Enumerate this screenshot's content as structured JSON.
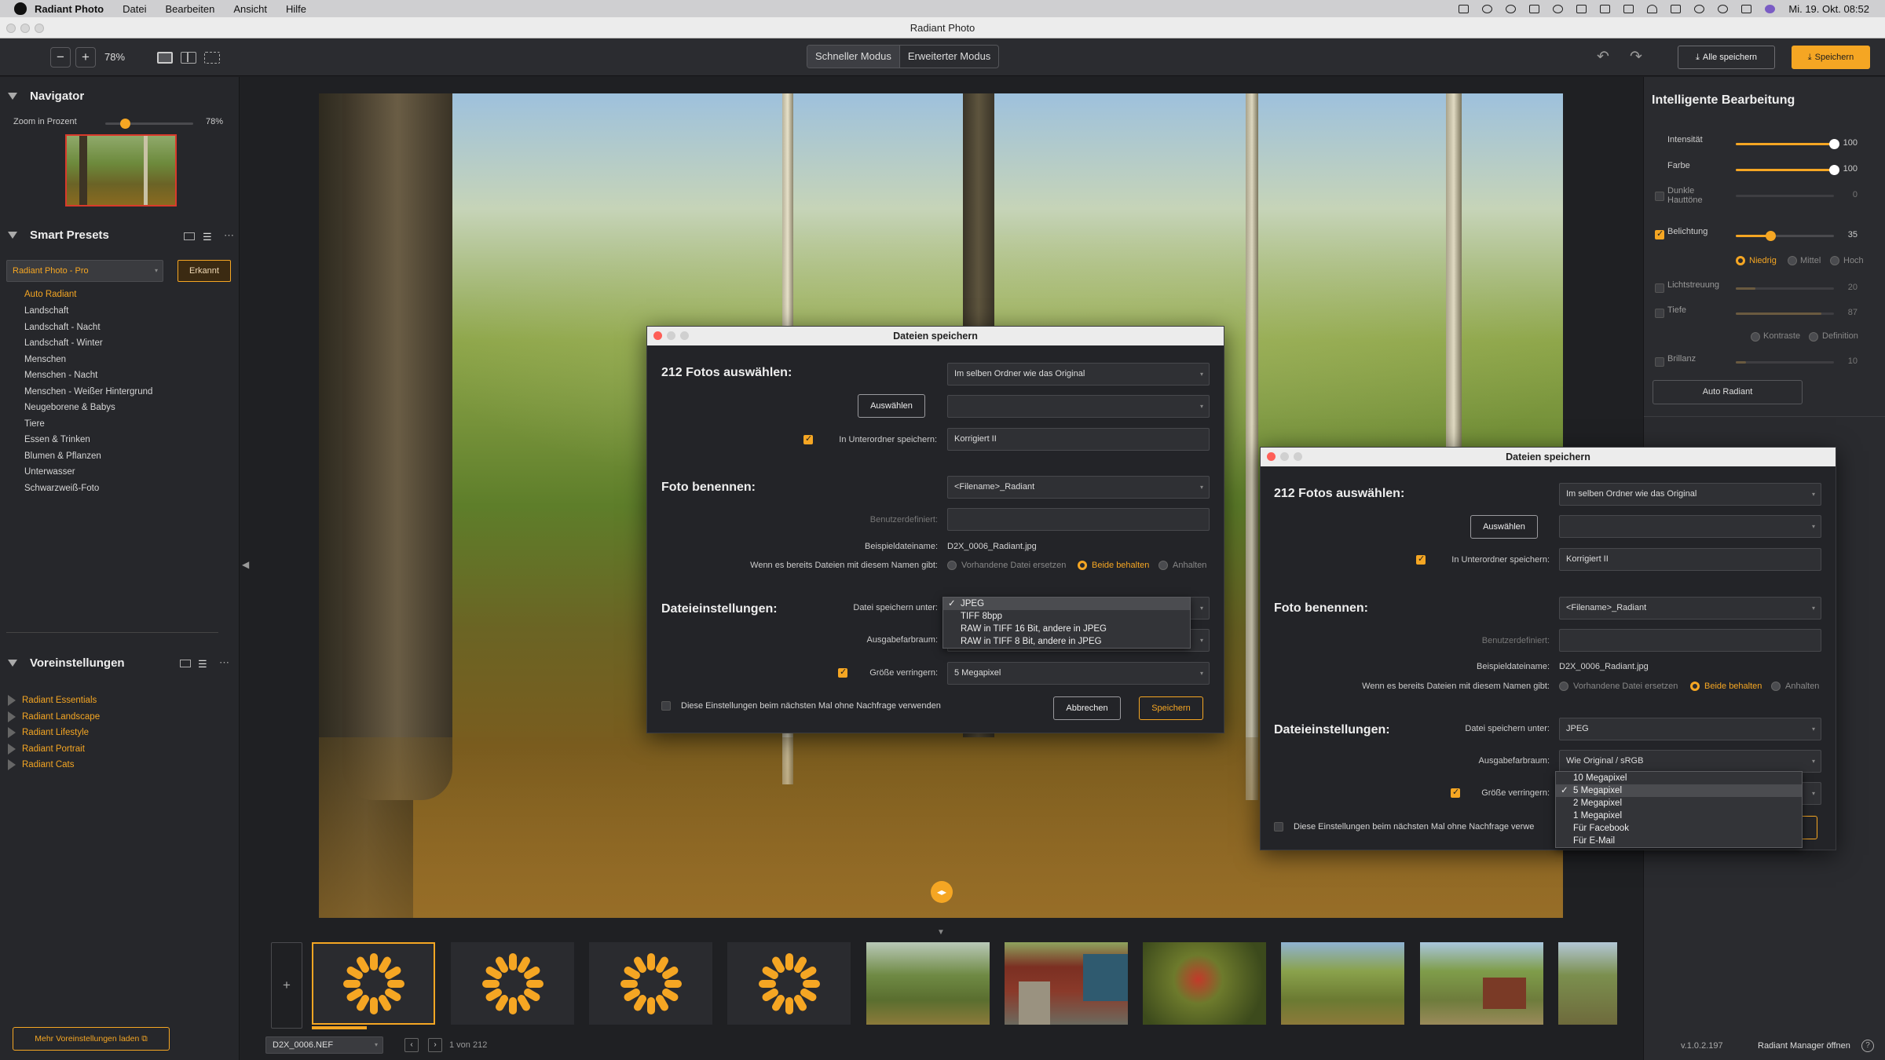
{
  "menubar": {
    "app": "Radiant Photo",
    "items": [
      "Datei",
      "Bearbeiten",
      "Ansicht",
      "Hilfe"
    ],
    "clock": "Mi. 19. Okt.  08:52"
  },
  "window": {
    "title": "Radiant Photo"
  },
  "toolbar": {
    "zoom_out": "−",
    "zoom_in": "+",
    "zoom": "78%",
    "mode_fast": "Schneller Modus",
    "mode_advanced": "Erweiterter Modus",
    "save_all": "Alle speichern",
    "save": "Speichern",
    "accent": "#f5a623"
  },
  "navigator": {
    "title": "Navigator",
    "zoom_label": "Zoom in Prozent",
    "zoom_value": "78%",
    "zoom_fraction": 0.22
  },
  "smart_presets": {
    "title": "Smart Presets",
    "selected": "Radiant Photo - Pro",
    "detected": "Erkannt",
    "items": [
      "Auto Radiant",
      "Landschaft",
      "Landschaft - Nacht",
      "Landschaft - Winter",
      "Menschen",
      "Menschen - Nacht",
      "Menschen - Weißer Hintergrund",
      "Neugeborene & Babys",
      "Tiere",
      "Essen & Trinken",
      "Blumen & Pflanzen",
      "Unterwasser",
      "Schwarzweiß-Foto"
    ]
  },
  "presets": {
    "title": "Voreinstellungen",
    "items": [
      "Radiant Essentials",
      "Radiant Landscape",
      "Radiant Lifestyle",
      "Radiant Portrait",
      "Radiant Cats"
    ],
    "load_more": "Mehr Voreinstellungen laden"
  },
  "smart_edit": {
    "title": "Intelligente Bearbeitung",
    "intensity": {
      "label": "Intensität",
      "value": "100"
    },
    "color": {
      "label": "Farbe",
      "value": "100"
    },
    "dark_skin": {
      "label": "Dunkle Hauttöne",
      "value": "0"
    },
    "exposure": {
      "label": "Belichtung",
      "value": "35"
    },
    "exposure_opts": [
      "Niedrig",
      "Mittel",
      "Hoch"
    ],
    "light_diffusion": {
      "label": "Lichtstreuung",
      "value": "20"
    },
    "depth": {
      "label": "Tiefe",
      "value": "87"
    },
    "depth_opts": [
      "Kontraste",
      "Definition"
    ],
    "brilliance": {
      "label": "Brillanz",
      "value": "10"
    },
    "auto": "Auto Radiant"
  },
  "dialog": {
    "title": "Dateien speichern",
    "select_photos": "212 Fotos auswählen:",
    "folder": "Im selben Ordner wie das Original",
    "choose": "Auswählen",
    "subfolder_label": "In Unterordner speichern:",
    "subfolder_value": "Korrigiert II",
    "name_photo": "Foto benennen:",
    "name_pattern": "<Filename>_Radiant",
    "custom_label": "Benutzerdefiniert:",
    "example_label": "Beispieldateiname:",
    "example_value": "D2X_0006_Radiant.jpg",
    "exists_label": "Wenn es bereits Dateien mit diesem Namen gibt:",
    "exists_opts": [
      "Vorhandene Datei ersetzen",
      "Beide behalten",
      "Anhalten"
    ],
    "file_settings": "Dateieinstellungen:",
    "save_as_label": "Datei speichern unter:",
    "save_as_value": "JPEG",
    "colorspace_label": "Ausgabefarbraum:",
    "colorspace_value": "Wie Original / sRGB",
    "reduce_label": "Größe verringern:",
    "reduce_value": "5 Megapixel",
    "remember": "Diese Einstellungen beim nächsten Mal ohne Nachfrage verwenden",
    "remember_cut": "Diese Einstellungen beim nächsten Mal ohne Nachfrage verwe",
    "cancel": "Abbrechen",
    "save": "Speichern",
    "format_options": [
      "JPEG",
      "TIFF 8bpp",
      "RAW in TIFF 16 Bit, andere in JPEG",
      "RAW in TIFF 8 Bit, andere in JPEG"
    ],
    "size_options": [
      "10 Megapixel",
      "5 Megapixel",
      "2 Megapixel",
      "1 Megapixel",
      "Für Facebook",
      "Für E-Mail"
    ]
  },
  "bottom": {
    "file": "D2X_0006.NEF",
    "count": "1 von 212",
    "version": "v.1.0.2.197",
    "manager": "Radiant Manager öffnen",
    "help": "?"
  }
}
